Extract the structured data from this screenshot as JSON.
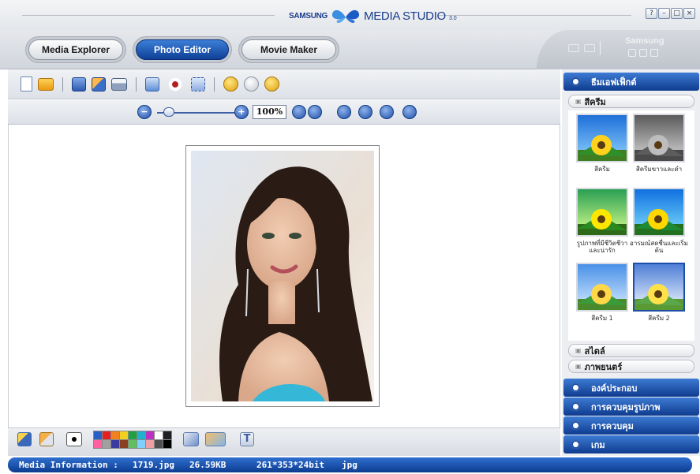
{
  "app": {
    "brand_samsung": "SAMSUNG",
    "brand_name": "MEDIA STUDIO",
    "brand_version": "3.0",
    "window_buttons": [
      "?",
      "–",
      "□",
      "×"
    ]
  },
  "modes": {
    "media_explorer": "Media Explorer",
    "photo_editor": "Photo Editor",
    "movie_maker": "Movie Maker",
    "active": "Photo Editor"
  },
  "device_side": {
    "label": "Samsung"
  },
  "toolbar": {
    "icons": [
      "new-file-icon",
      "open-folder-icon",
      "save-icon",
      "save-as-icon",
      "print-icon",
      "image-adjust-icon",
      "red-eye-icon",
      "crop-icon",
      "undo-icon",
      "redo-icon",
      "reset-icon"
    ]
  },
  "zoom": {
    "minus": "−",
    "plus": "+",
    "value": "100%",
    "level": 0.1,
    "fit_buttons": [
      "fit-icon",
      "actual-size-icon",
      "flip-horizontal-icon",
      "flip-vertical-icon",
      "rotate-right-icon",
      "rotate-left-icon"
    ]
  },
  "palette": [
    "#2860c8",
    "#e62020",
    "#f08020",
    "#f0d020",
    "#20a040",
    "#20b0d0",
    "#c030c0",
    "#ffffff",
    "#202020",
    "#ff60a0",
    "#a0a0a0",
    "#3a3aa0",
    "#8a4020",
    "#60c060",
    "#80d0ff",
    "#f0a0a0",
    "#505050",
    "#000000"
  ],
  "status": {
    "label": "Media Information :",
    "filename": "1719.jpg",
    "size": "26.59KB",
    "dims": "261*353*24bit",
    "format": "jpg"
  },
  "right_panel": {
    "theme_header": "ธีมเอฟเฟ็กต์",
    "sub_active": "สีครีม",
    "thumbs": [
      {
        "label": "สีครีม",
        "style": "color"
      },
      {
        "label": "สีครีมขาวและดำ",
        "style": "gray"
      },
      {
        "label": "รูปภาพที่มีชีวิตชีวาและน่ารัก",
        "style": "vivid"
      },
      {
        "label": "อารมณ์สดชื่นและเริ่มต้น",
        "style": "fresh"
      },
      {
        "label": "สีครีม 1",
        "style": "soft"
      },
      {
        "label": "สีครีม 2",
        "style": "bright",
        "selected": true
      }
    ],
    "sub_style": "สไตล์",
    "sub_film": "ภาพยนตร์",
    "headers": [
      "องค์ประกอบ",
      "การควบคุมรูปภาพ",
      "การควบคุม",
      "เกม"
    ]
  }
}
